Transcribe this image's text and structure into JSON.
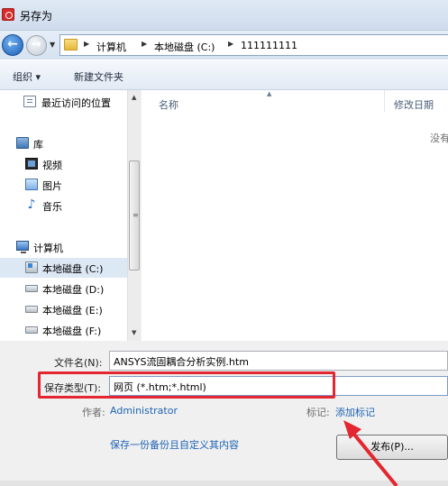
{
  "window": {
    "title": "另存为"
  },
  "breadcrumb": [
    "计算机",
    "本地磁盘 (C:)",
    "111111111"
  ],
  "toolbar": {
    "organize": "组织 ▾",
    "new_folder": "新建文件夹"
  },
  "sidebar": {
    "recent": "最近访问的位置",
    "library": "库",
    "video": "视频",
    "pictures": "图片",
    "music": "音乐",
    "computer": "计算机",
    "drives": [
      "本地磁盘 (C:)",
      "本地磁盘 (D:)",
      "本地磁盘 (E:)",
      "本地磁盘 (F:)"
    ]
  },
  "filelist": {
    "col_name": "名称",
    "col_modified": "修改日期",
    "empty_text": "没有"
  },
  "form": {
    "filename_label": "文件名(N):",
    "filename_value": "ANSYS流固耦合分析实例.htm",
    "filetype_label": "保存类型(T):",
    "filetype_value": "网页 (*.htm;*.html)",
    "author_label": "作者:",
    "author_value": "Administrator",
    "tags_label": "标记:",
    "tags_value": "添加标记",
    "backup_link": "保存一份备份且自定义其内容",
    "publish_button": "发布(P)..."
  },
  "colors": {
    "highlight": "#e3262f",
    "link": "#1e64b4"
  }
}
